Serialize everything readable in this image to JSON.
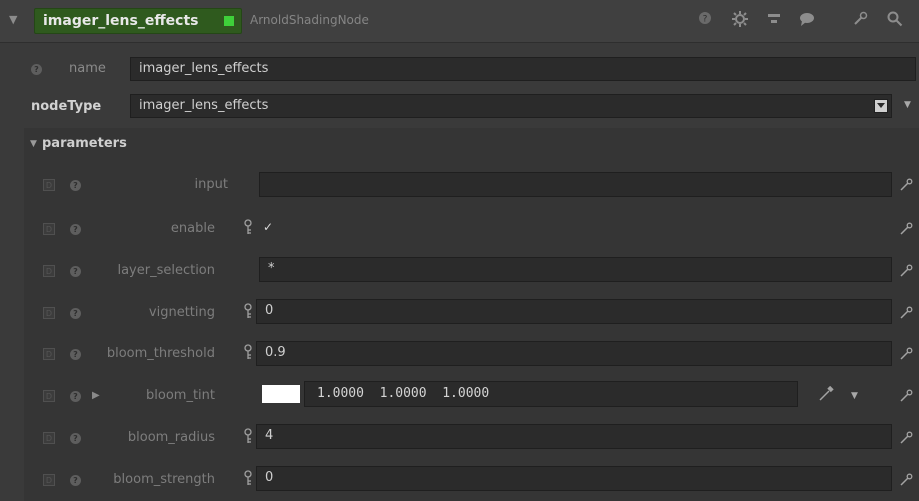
{
  "header": {
    "node_name": "imager_lens_effects",
    "node_type": "ArnoldShadingNode",
    "icons": [
      "help-icon",
      "settings-icon",
      "hierarchy-icon",
      "comment-icon",
      "wrench-icon",
      "search-icon"
    ]
  },
  "name_row": {
    "label": "name",
    "value": "imager_lens_effects"
  },
  "node_type_row": {
    "label": "nodeType",
    "value": "imager_lens_effects"
  },
  "parameters": {
    "title": "parameters",
    "items": [
      {
        "label": "input",
        "value": ""
      },
      {
        "label": "enable",
        "value": "✓"
      },
      {
        "label": "layer_selection",
        "value": "*"
      },
      {
        "label": "vignetting",
        "value": "0"
      },
      {
        "label": "bloom_threshold",
        "value": "0.9"
      },
      {
        "label": "bloom_tint",
        "value": "1.0000  1.0000  1.0000"
      },
      {
        "label": "bloom_radius",
        "value": "4"
      },
      {
        "label": "bloom_strength",
        "value": "0"
      }
    ]
  },
  "colors": {
    "node_name_bg": "#2f5a1e",
    "status_green": "#3fd13a",
    "panel_bg": "#3a3a3a",
    "field_bg": "#2b2b2b",
    "tint_swatch": "#ffffff"
  }
}
